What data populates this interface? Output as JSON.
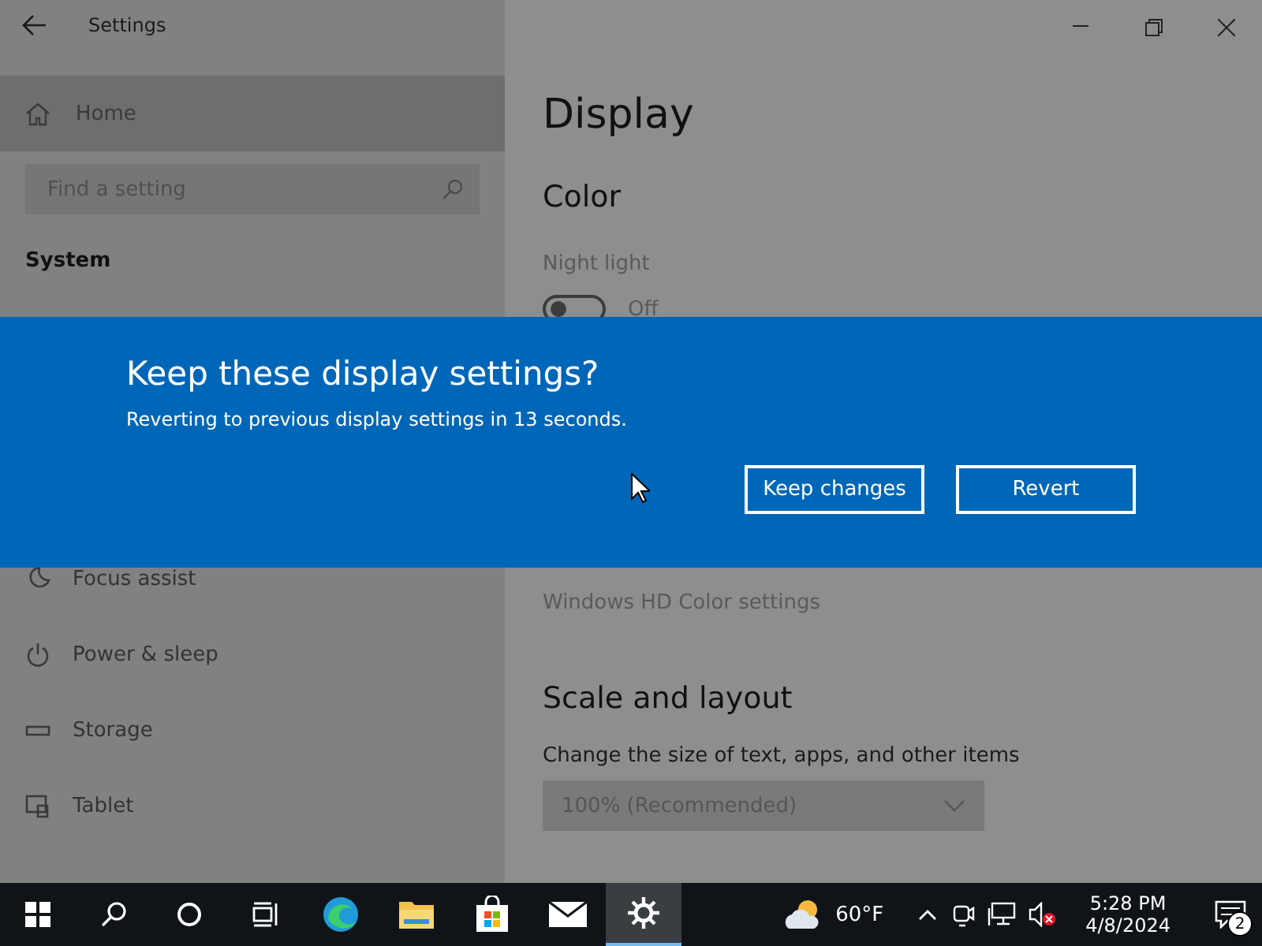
{
  "window": {
    "title": "Settings"
  },
  "sidebar": {
    "home": "Home",
    "search": {
      "placeholder": "Find a setting"
    },
    "section": "System",
    "items": [
      {
        "label": "Focus assist",
        "kind": "moon"
      },
      {
        "label": "Power & sleep",
        "kind": "power"
      },
      {
        "label": "Storage",
        "kind": "storage"
      },
      {
        "label": "Tablet",
        "kind": "tablet"
      }
    ]
  },
  "content": {
    "title": "Display",
    "color_heading": "Color",
    "night_light": {
      "label": "Night light",
      "on": false,
      "state": "Off"
    },
    "hdr_link": "Windows HD Color settings",
    "scale_heading": "Scale and layout",
    "scale_label": "Change the size of text, apps, and other items",
    "scale_value": "100% (Recommended)"
  },
  "dialog": {
    "title": "Keep these display settings?",
    "message": "Reverting to previous display settings in 13 seconds.",
    "buttons": [
      "Keep changes",
      "Revert"
    ]
  },
  "taskbar": {
    "apps": [
      {
        "kind": "start",
        "active": false
      },
      {
        "kind": "search",
        "active": false
      },
      {
        "kind": "cortana",
        "active": false
      },
      {
        "kind": "taskview",
        "active": false
      },
      {
        "kind": "edge",
        "active": false
      },
      {
        "kind": "explorer",
        "active": false
      },
      {
        "kind": "store",
        "active": false
      },
      {
        "kind": "mail",
        "active": false
      },
      {
        "kind": "settings",
        "active": true
      }
    ],
    "weather": "60°F",
    "time": "5:28 PM",
    "date": "4/8/2024",
    "notifications": "2"
  }
}
